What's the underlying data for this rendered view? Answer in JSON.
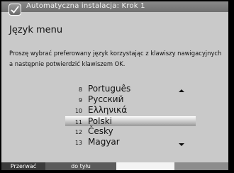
{
  "header": {
    "title": "Automatyczna instalacja: Krok 1"
  },
  "heading": "Język menu",
  "instruction": "Proszę wybrać preferowany język korzystając z klawiszy nawigacyjnych a następnie potwierdzić klawiszem OK.",
  "languages": [
    {
      "number": "8",
      "name": "Português"
    },
    {
      "number": "9",
      "name": "Русский"
    },
    {
      "number": "10",
      "name": "Ελληνικά"
    },
    {
      "number": "11",
      "name": "Polski"
    },
    {
      "number": "12",
      "name": "Česky"
    },
    {
      "number": "13",
      "name": "Magyar"
    }
  ],
  "selected_index": 3,
  "footer": {
    "abort_label": "Przerwać",
    "back_label": "do tyłu"
  },
  "colors": {
    "background": "#c9c9c9",
    "titlebar": "#7a7a7a",
    "footer_white": "#f4f4f4",
    "footer_gray": "#8c8c8c"
  }
}
